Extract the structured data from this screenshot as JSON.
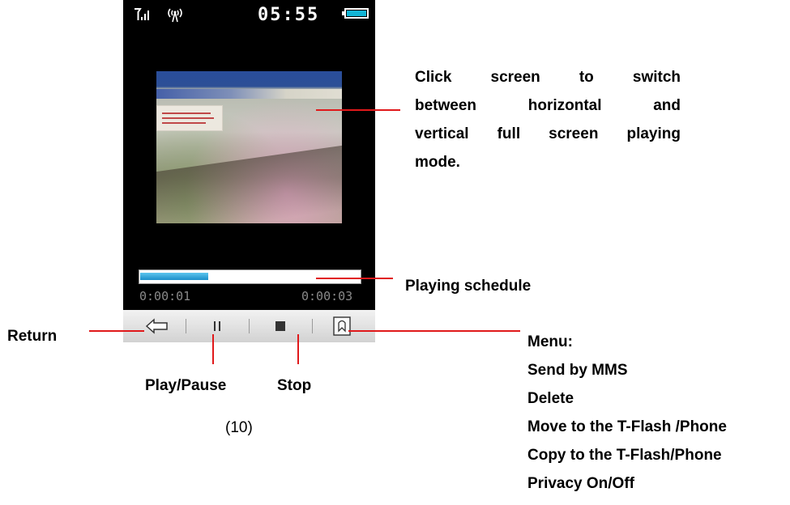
{
  "status_bar": {
    "time": "05:55",
    "icons": [
      "signal-icon",
      "wifi-icon",
      "battery-icon"
    ],
    "battery_color": "#12b5d6"
  },
  "player": {
    "progress_fraction": 0.31,
    "elapsed": "0:00:01",
    "total": "0:00:03",
    "controls": [
      "return-icon",
      "pause-icon",
      "stop-icon",
      "menu-icon"
    ]
  },
  "annotations": {
    "switch_lines": [
      "Click screen to switch",
      "between horizontal and",
      "vertical full screen playing",
      "mode."
    ],
    "schedule": "Playing schedule",
    "return": "Return",
    "play_pause": "Play/Pause",
    "stop": "Stop",
    "menu_title": "Menu:",
    "menu_items": [
      "Send by MMS",
      "Delete",
      "Move to the T-Flash /Phone",
      "Copy to the T-Flash/Phone",
      "Privacy On/Off"
    ]
  },
  "caption": "(10)",
  "colors": {
    "leader_line": "#e0191b",
    "progress": "#1b8fca"
  }
}
